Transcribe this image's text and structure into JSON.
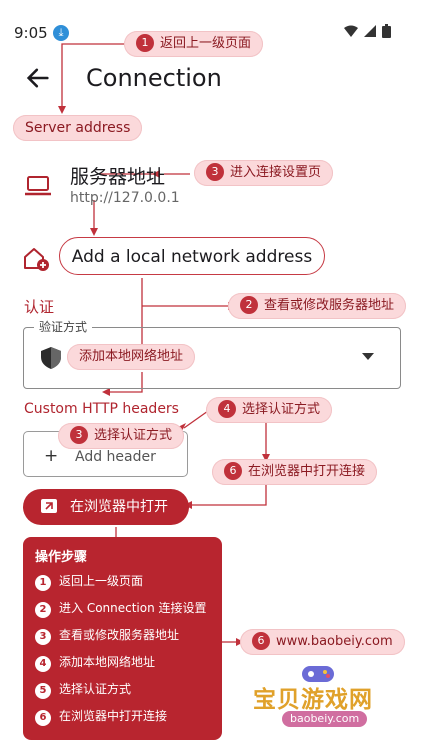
{
  "status_bar": {
    "time": "9:05",
    "download_badge": "⤓",
    "icons": [
      "wifi-icon",
      "signal-icon",
      "battery-icon"
    ]
  },
  "header": {
    "title": "Connection",
    "back_icon": "arrow-left-icon"
  },
  "server": {
    "title": "服务器地址",
    "address": "http://127.0.0.1"
  },
  "add_local": {
    "label": "Add a local network address"
  },
  "auth": {
    "section_label": "认证",
    "field_legend": "验证方式"
  },
  "custom_headers": {
    "section_label": "Custom HTTP headers",
    "add_button": "Add header",
    "plus": "+"
  },
  "open_browser": {
    "label": "在浏览器中打开"
  },
  "annotations": {
    "a1": {
      "num": "1",
      "text": "返回上一级页面"
    },
    "server_address": {
      "text": "Server address"
    },
    "a3_top": {
      "num": "3",
      "text": "进入连接设置页"
    },
    "a2": {
      "num": "2",
      "text": "查看或修改服务器地址"
    },
    "add_local_note": {
      "text": "添加本地网络地址"
    },
    "a4": {
      "num": "4",
      "text": "选择认证方式"
    },
    "a3_mid": {
      "num": "3",
      "text": "选择认证方式"
    },
    "a6": {
      "num": "6",
      "text": "在浏览器中打开连接"
    },
    "a6_url": {
      "num": "6",
      "text": "www.baobeiy.com"
    }
  },
  "steps": {
    "title": "操作步骤",
    "items": [
      {
        "num": "1",
        "text": "返回上一级页面"
      },
      {
        "num": "2",
        "text": "进入 Connection 连接设置"
      },
      {
        "num": "3",
        "text": "查看或修改服务器地址"
      },
      {
        "num": "4",
        "text": "添加本地网络地址"
      },
      {
        "num": "5",
        "text": "选择认证方式"
      },
      {
        "num": "6",
        "text": "在浏览器中打开连接"
      }
    ]
  },
  "watermark": {
    "main": "宝贝游戏网",
    "sub": "baobeiy.com"
  },
  "colors": {
    "accent": "#b8252f",
    "pill_bg": "#fbd9db",
    "pill_text": "#8b1a22"
  }
}
